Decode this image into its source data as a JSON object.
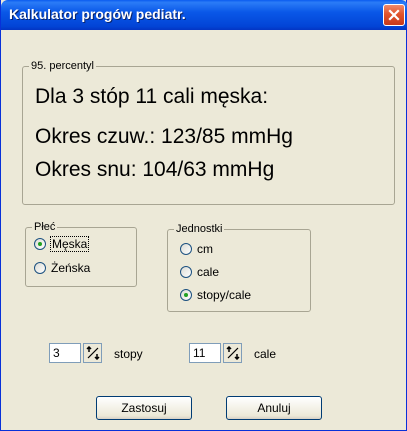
{
  "window": {
    "title": "Kalkulator progów pediatr."
  },
  "percentile_group": {
    "legend": "95. percentyl",
    "heading": "Dla 3 stóp 11 cali męska:",
    "awake_line": "Okres czuw.: 123/85 mmHg",
    "sleep_line": "Okres snu: 104/63 mmHg"
  },
  "sex_group": {
    "legend": "Płeć",
    "options": [
      {
        "label": "Męska",
        "checked": true
      },
      {
        "label": "Żeńska",
        "checked": false
      }
    ]
  },
  "units_group": {
    "legend": "Jednostki",
    "options": [
      {
        "label": "cm",
        "checked": false
      },
      {
        "label": "cale",
        "checked": false
      },
      {
        "label": "stopy/cale",
        "checked": true
      }
    ]
  },
  "height_inputs": {
    "feet_value": "3",
    "feet_unit": "stopy",
    "inches_value": "11",
    "inches_unit": "cale"
  },
  "buttons": {
    "apply": "Zastosuj",
    "cancel": "Anuluj"
  },
  "colors": {
    "titlebar": "#0a58e8",
    "close_button": "#e1542c",
    "dialog_bg": "#ece9d8",
    "radio_dot": "#21a121"
  }
}
